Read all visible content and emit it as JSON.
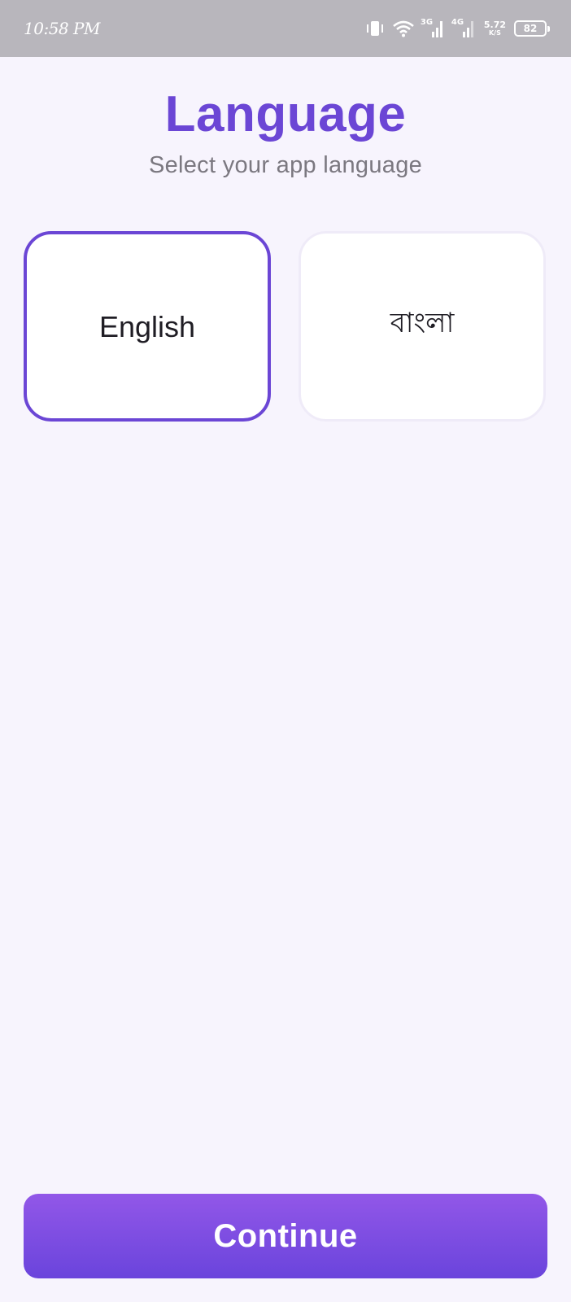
{
  "status_bar": {
    "time": "10:58 PM",
    "vibrate_icon": "vibrate-icon",
    "wifi_icon": "wifi-icon",
    "network_1": "3G",
    "network_2": "4G",
    "speed_value": "5.72",
    "speed_unit": "K/S",
    "battery": "82"
  },
  "header": {
    "title": "Language",
    "subtitle": "Select your app language"
  },
  "languages": [
    {
      "label": "English",
      "selected": true
    },
    {
      "label": "বাংলা",
      "selected": false
    }
  ],
  "footer": {
    "continue_label": "Continue"
  },
  "colors": {
    "accent": "#6b46d5",
    "background": "#f7f4fd",
    "button_gradient_top": "#9257e8",
    "button_gradient_bottom": "#6a44dc",
    "status_bar": "#b8b6bc"
  }
}
